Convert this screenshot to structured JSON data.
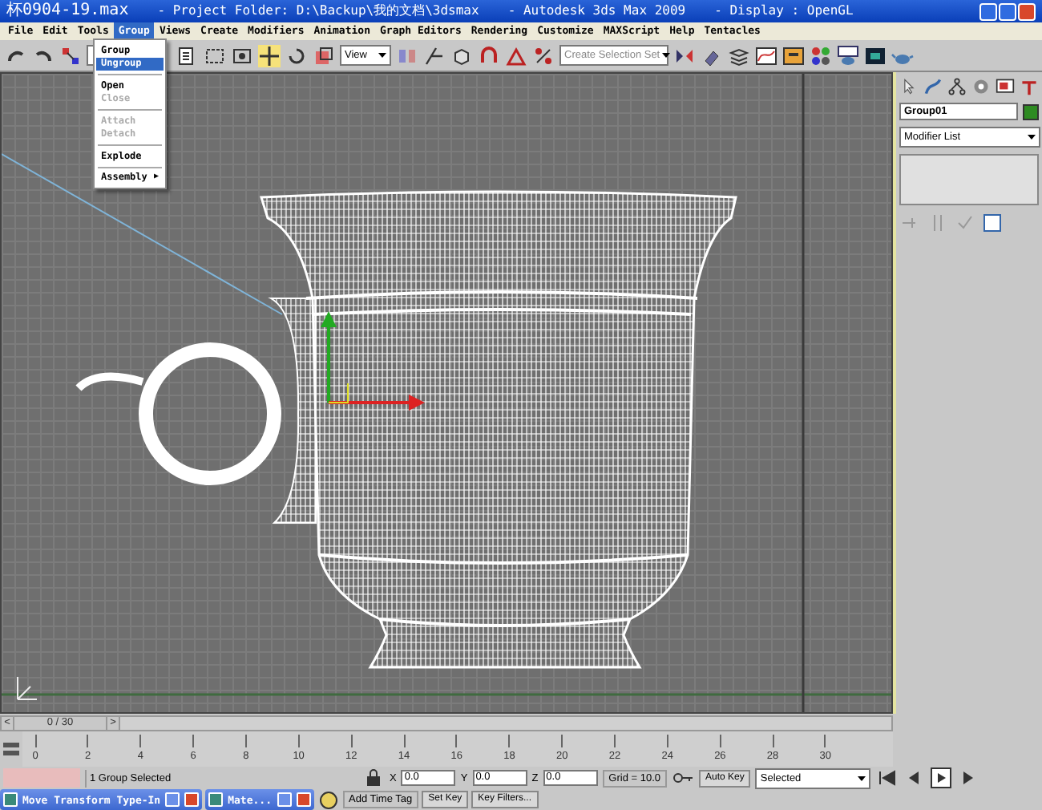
{
  "window": {
    "title_parts": [
      "杯0904-19.max",
      "- Project Folder: D:\\Backup\\我的文档\\3dsmax",
      "- Autodesk 3ds Max  2009",
      "- Display : OpenGL"
    ]
  },
  "menu": [
    {
      "label": "File",
      "selected": false
    },
    {
      "label": "Edit",
      "selected": false
    },
    {
      "label": "Tools",
      "selected": false
    },
    {
      "label": "Group",
      "selected": true
    },
    {
      "label": "Views",
      "selected": false
    },
    {
      "label": "Create",
      "selected": false
    },
    {
      "label": "Modifiers",
      "selected": false
    },
    {
      "label": "Animation",
      "selected": false
    },
    {
      "label": "Graph Editors",
      "selected": false
    },
    {
      "label": "Rendering",
      "selected": false
    },
    {
      "label": "Customize",
      "selected": false
    },
    {
      "label": "MAXScript",
      "selected": false
    },
    {
      "label": "Help",
      "selected": false
    },
    {
      "label": "Tentacles",
      "selected": false
    }
  ],
  "group_menu": [
    {
      "kind": "item",
      "label": "Group",
      "selected": false,
      "disabled": false
    },
    {
      "kind": "item",
      "label": "Ungroup",
      "selected": true,
      "disabled": false
    },
    {
      "kind": "separator"
    },
    {
      "kind": "item",
      "label": "Open",
      "selected": false,
      "disabled": false
    },
    {
      "kind": "item",
      "label": "Close",
      "selected": false,
      "disabled": true
    },
    {
      "kind": "separator"
    },
    {
      "kind": "item",
      "label": "Attach",
      "selected": false,
      "disabled": true
    },
    {
      "kind": "item",
      "label": "Detach",
      "selected": false,
      "disabled": true
    },
    {
      "kind": "separator"
    },
    {
      "kind": "item",
      "label": "Explode",
      "selected": false,
      "disabled": false
    },
    {
      "kind": "separator"
    },
    {
      "kind": "submenu",
      "label": "Assembly",
      "arrow": "▶",
      "selected": false,
      "disabled": false
    }
  ],
  "toolbar": {
    "view_dropdown": "View",
    "selection_set": "Create Selection Set"
  },
  "command_panel": {
    "object_name": "Group01",
    "modifier_list": "Modifier List"
  },
  "time_slider": {
    "prev": "<",
    "frame": "0 / 30",
    "next": ">"
  },
  "track_ticks": [
    "0",
    "2",
    "4",
    "6",
    "8",
    "10",
    "12",
    "14",
    "16",
    "18",
    "20",
    "22",
    "24",
    "26",
    "28",
    "30"
  ],
  "status": {
    "selection": "1 Group Selected",
    "coords": [
      {
        "axis": "X",
        "value": "0.0"
      },
      {
        "axis": "Y",
        "value": "0.0"
      },
      {
        "axis": "Z",
        "value": "0.0"
      }
    ],
    "grid": "Grid = 10.0",
    "add_time_tag": "Add Time Tag",
    "auto_key": "Auto Key",
    "set_key": "Set Key",
    "key_mode": "Selected",
    "key_filters": "Key Filters..."
  },
  "taskbar": [
    {
      "label": "Move Transform Type-In"
    },
    {
      "label": "Mate..."
    }
  ]
}
